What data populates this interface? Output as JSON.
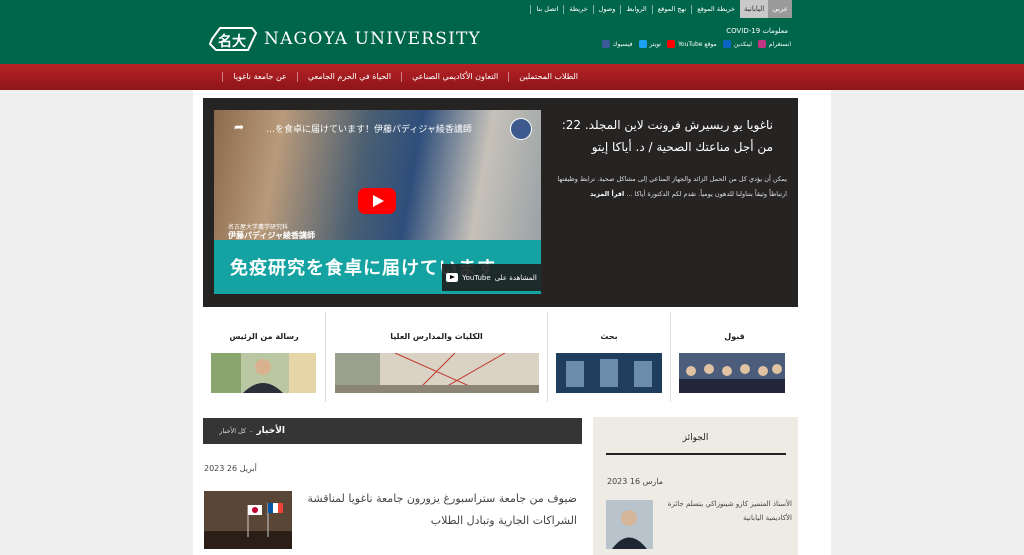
{
  "header": {
    "lang_active": "عربي",
    "lang_other": "اليابانية",
    "top_links": [
      "خريطة الموقع",
      "نهج الموقع",
      "الروابط",
      "وصول",
      "خريطة",
      "اتصل بنا"
    ],
    "logo_text": "NAGOYA UNIVERSITY",
    "covid": "COVID-19 معلومات",
    "social": [
      {
        "label": "انستغرام",
        "icon": "instagram-icon",
        "color": "#c13584"
      },
      {
        "label": "لينكدين",
        "icon": "linkedin-icon",
        "color": "#0a66c2"
      },
      {
        "label": "YouTube موقع",
        "icon": "youtube-icon",
        "color": "#ff0000"
      },
      {
        "label": "تويتر",
        "icon": "twitter-icon",
        "color": "#1da1f2"
      },
      {
        "label": "فيسبوك",
        "icon": "facebook-icon",
        "color": "#3b5998"
      }
    ]
  },
  "nav": {
    "items": [
      "الطلاب المحتملين",
      "التعاون الأكاديمي الصناعي",
      "الحياة في الحرم الجامعي",
      "عن جامعة ناغويا"
    ]
  },
  "feature": {
    "video_title": "…を食卓に届けています！伊藤パディジャ綾香講師",
    "caption_small": "名古屋大学農学研究科",
    "caption_name": "伊藤パディジャ綾香講師",
    "band_text": "免疫研究を食卓に届けています",
    "watch_label": "المشاهدة على",
    "watch_brand": "YouTube",
    "title": "ناغويا يو ريسيرش فرونت لاين المجلد. 22: من أجل مناعتك الصحية / د. أياكا إيتو",
    "body": "يمكن أن يؤدي كل من الحمل الزائد والجهاز المناعي إلى مشاكل صحية. ترابط وظيفتها ارتباطاً وثيقاً بتناولنا للدهون يومياً. تقدم لكم الدكتورة أياكا ...",
    "more": "اقرأ المزيد"
  },
  "categories": [
    {
      "label": "رسالة من الرئيس"
    },
    {
      "label": "الكليات والمدارس العليا"
    },
    {
      "label": "بحث"
    },
    {
      "label": "قبول"
    }
  ],
  "news": {
    "title": "الأخبار",
    "all_link": "كل الأخبار",
    "separator": "-",
    "date": "أبريل 26 2023",
    "item": "ضيوف من جامعة ستراسبورغ يزورون جامعة ناغويا لمناقشة الشراكات الجارية وتبادل الطلاب"
  },
  "awards": {
    "title": "الجوائز",
    "date": "مارس 16 2023",
    "item": "الأستاذ المتميز كازو شينوزاكي يتسلم جائزة الأكاديمية اليابانية"
  }
}
